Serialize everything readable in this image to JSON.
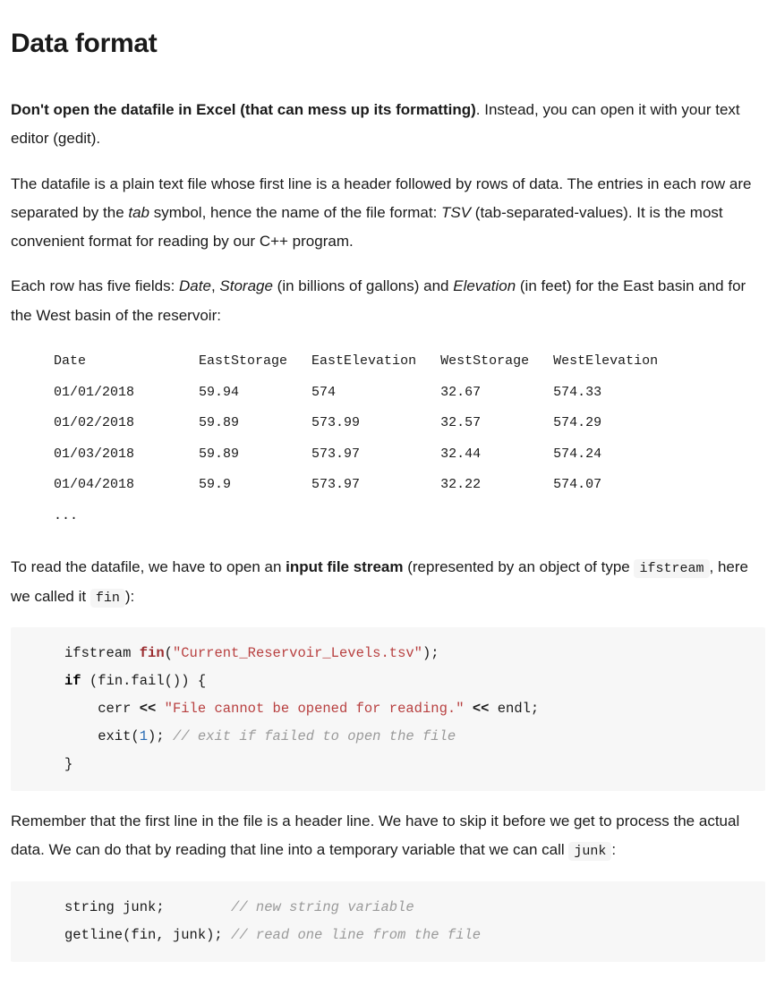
{
  "heading": "Data format",
  "p1_bold": "Don't open the datafile in Excel (that can mess up its formatting)",
  "p1_rest": ". Instead, you can open it with your text editor (gedit).",
  "p2_a": "The datafile is a plain text file whose first line is a header followed by rows of data. The entries in each row are separated by the ",
  "p2_tab": "tab",
  "p2_b": " symbol, hence the name of the file format: ",
  "p2_tsv": "TSV",
  "p2_c": " (tab-separated-values). It is the most convenient format for reading by our C++ program.",
  "p3_a": "Each row has five fields: ",
  "p3_date": "Date",
  "p3_sep1": ", ",
  "p3_storage": "Storage",
  "p3_b": " (in billions of gallons) and ",
  "p3_elev": "Elevation",
  "p3_c": " (in feet) for the East basin and for the West basin of the reservoir:",
  "table": {
    "headers": [
      "Date",
      "EastStorage",
      "EastElevation",
      "WestStorage",
      "WestElevation"
    ],
    "rows": [
      [
        "01/01/2018",
        "59.94",
        "574",
        "32.67",
        "574.33"
      ],
      [
        "01/02/2018",
        "59.89",
        "573.99",
        "32.57",
        "574.29"
      ],
      [
        "01/03/2018",
        "59.89",
        "573.97",
        "32.44",
        "574.24"
      ],
      [
        "01/04/2018",
        "59.9",
        "573.97",
        "32.22",
        "574.07"
      ]
    ],
    "ellipsis": "..."
  },
  "p4_a": "To read the datafile, we have to open an ",
  "p4_bold": "input file stream",
  "p4_b": " (represented by an object of type ",
  "p4_code1": "ifstream",
  "p4_c": ", here we called it ",
  "p4_code2": "fin",
  "p4_d": "):",
  "code1": {
    "l1": {
      "a": "ifstream ",
      "fn": "fin",
      "b": "(",
      "str": "\"Current_Reservoir_Levels.tsv\"",
      "c": ");"
    },
    "l2": {
      "kw": "if",
      "a": " (fin.fail()) {"
    },
    "l3": {
      "a": "    cerr ",
      "op": "<<",
      "b": " ",
      "str": "\"File cannot be opened for reading.\"",
      "c": " ",
      "op2": "<<",
      "d": " endl;"
    },
    "l4": {
      "a": "    exit(",
      "num": "1",
      "b": "); ",
      "cmt": "// exit if failed to open the file"
    },
    "l5": {
      "a": "}"
    }
  },
  "p5_a": "Remember that the first line in the file is a header line. We have to skip it before we get to process the actual data. We can do that by reading that line into a temporary variable that we can call ",
  "p5_code": "junk",
  "p5_b": ":",
  "code2": {
    "l1": {
      "a": "string junk;        ",
      "cmt": "// new string variable"
    },
    "l2": {
      "a": "getline(fin, junk); ",
      "cmt": "// read one line from the file"
    }
  }
}
